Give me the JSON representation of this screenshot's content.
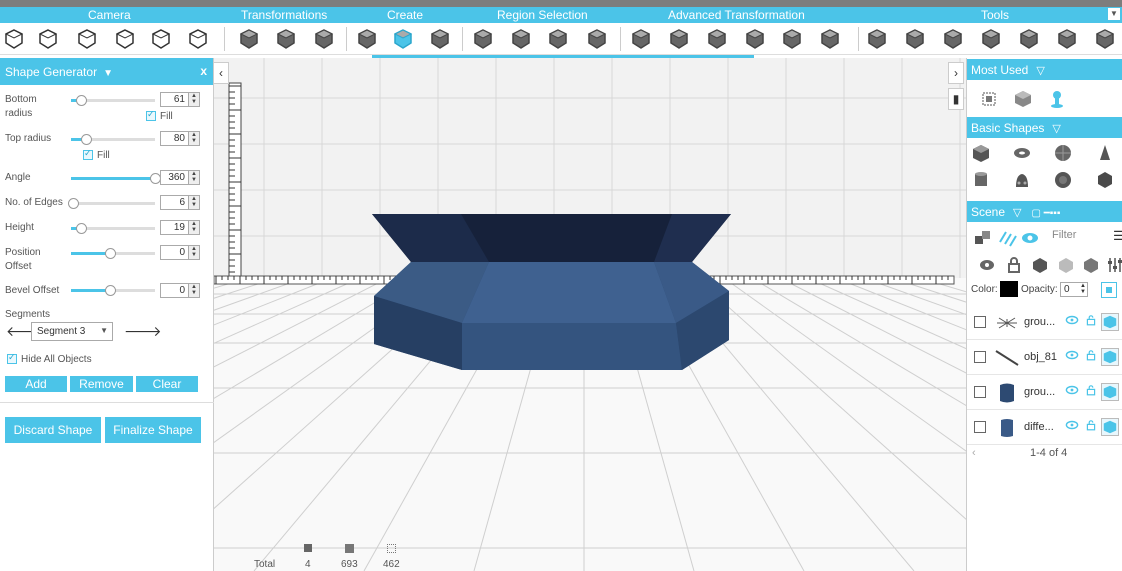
{
  "categories": [
    "Camera",
    "Transformations",
    "Create",
    "Region Selection",
    "Advanced Transformation",
    "Tools"
  ],
  "shape_generator": {
    "title": "Shape Generator",
    "close": "x",
    "bottom_radius": {
      "label": "Bottom radius",
      "value": "61",
      "level": 0.12
    },
    "bottom_fill": "Fill",
    "top_radius": {
      "label": "Top radius",
      "value": "80",
      "level": 0.18
    },
    "top_fill": "Fill",
    "angle": {
      "label": "Angle",
      "value": "360",
      "level": 1.0
    },
    "edges": {
      "label": "No. of Edges",
      "value": "6",
      "level": 0.02
    },
    "height": {
      "label": "Height",
      "value": "19",
      "level": 0.12
    },
    "position_offset": {
      "label": "Position Offset",
      "value": "0",
      "level": 0.47
    },
    "bevel_offset": {
      "label": "Bevel Offset",
      "value": "0",
      "level": 0.47
    },
    "segments_label": "Segments",
    "segment_selected": "Segment 3",
    "hide_all": "Hide All Objects",
    "add": "Add",
    "remove": "Remove",
    "clear": "Clear",
    "discard": "Discard Shape",
    "finalize": "Finalize Shape"
  },
  "stats": {
    "label": "Total",
    "objects": "4",
    "faces": "693",
    "vertices": "462"
  },
  "right": {
    "most_used": "Most Used",
    "basic_shapes": "Basic Shapes",
    "scene": "Scene",
    "filter": "Filter",
    "color_label": "Color:",
    "opacity_label": "Opacity:",
    "opacity_value": "0",
    "objects": [
      {
        "name": "grou..."
      },
      {
        "name": "obj_81"
      },
      {
        "name": "grou..."
      },
      {
        "name": "diffe..."
      }
    ],
    "pager": "1-4 of 4"
  },
  "colors": {
    "accent": "#4bc4e8",
    "shape": "#2d4a72"
  }
}
